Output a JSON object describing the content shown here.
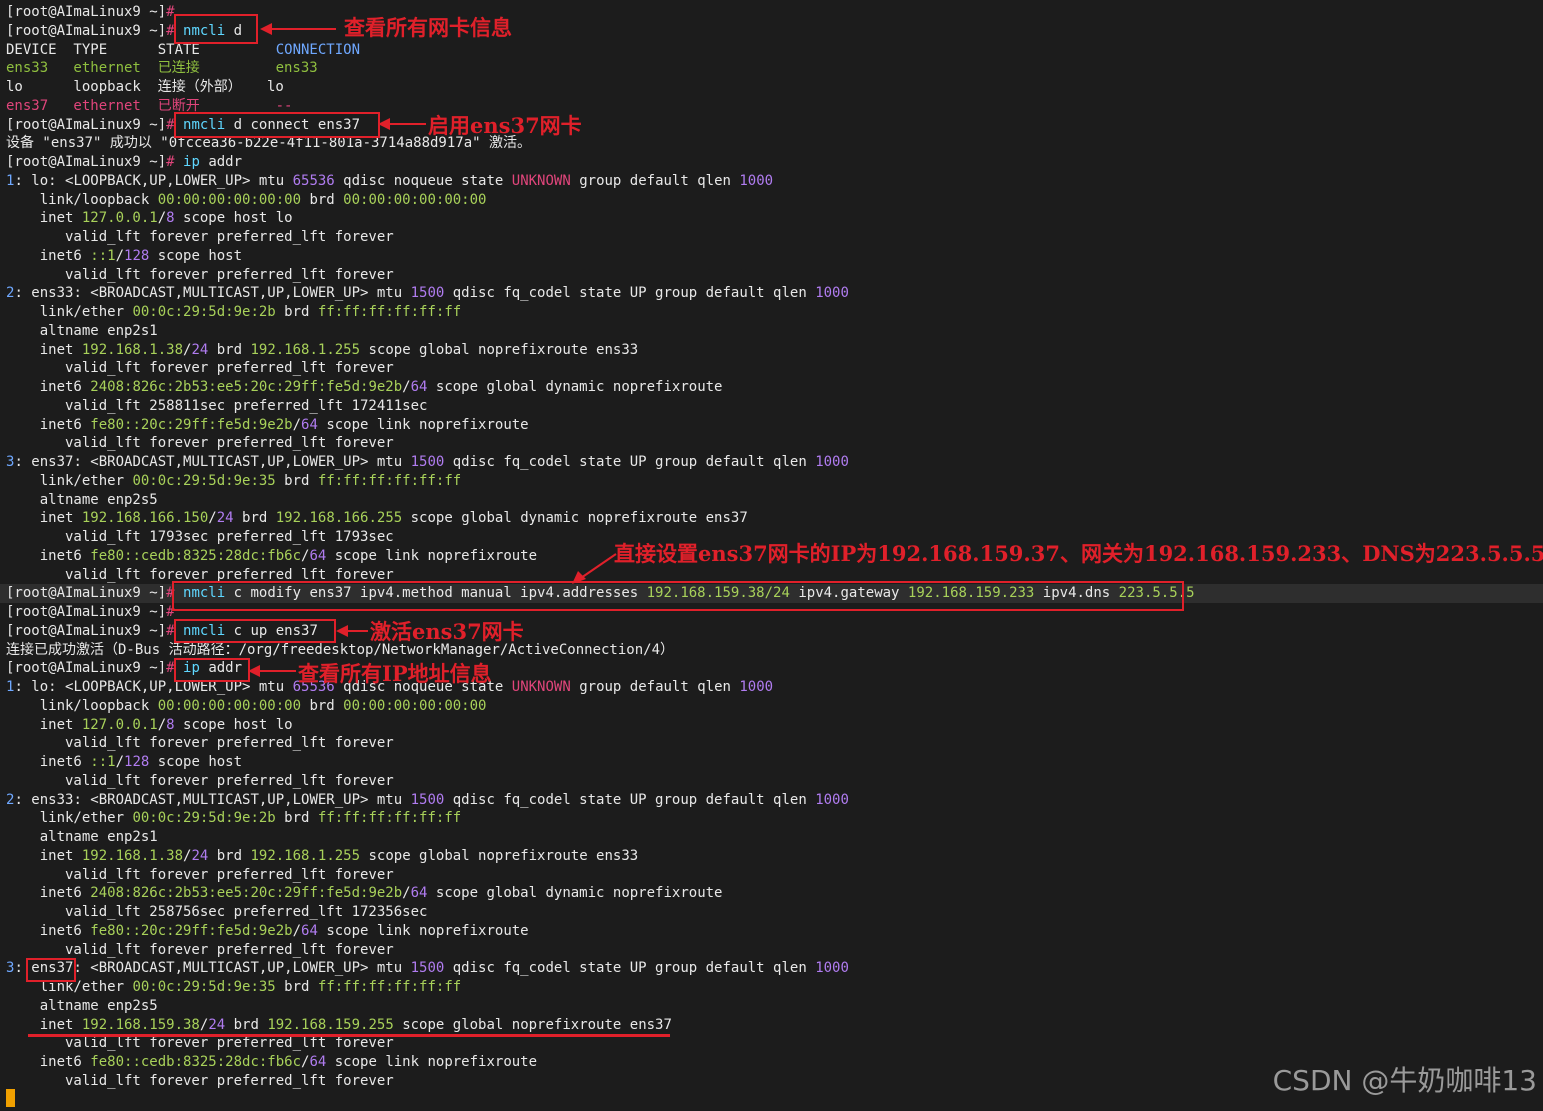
{
  "prompt": "[root@AImaLinux9 ~]",
  "hash": "#",
  "annotations": {
    "a1": "查看所有网卡信息",
    "a2": "启用ens37网卡",
    "a3": "直接设置ens37网卡的IP为192.168.159.37、网关为192.168.159.233、DNS为223.5.5.5",
    "a4": "激活ens37网卡",
    "a5": "查看所有IP地址信息"
  },
  "watermark": "CSDN @牛奶咖啡13",
  "lines": [
    [
      [
        "[root@AImaLinux9 ~]",
        "w"
      ],
      [
        "#",
        "rd"
      ]
    ],
    [
      [
        "[root@AImaLinux9 ~]",
        "w"
      ],
      [
        "#",
        "rd"
      ],
      [
        " nmcli",
        "cy"
      ],
      [
        " d",
        "w"
      ]
    ],
    [
      [
        "DEVICE  TYPE      STATE         ",
        "w"
      ],
      [
        "CONNECTION",
        "bl"
      ]
    ],
    [
      [
        "ens33   ethernet  已连接         ens33",
        "gr"
      ]
    ],
    [
      [
        "lo      loopback  连接（外部）   lo",
        "yl"
      ]
    ],
    [
      [
        "ens37   ethernet  已断开         --",
        "rd"
      ]
    ],
    [
      [
        "[root@AImaLinux9 ~]",
        "w"
      ],
      [
        "#",
        "rd"
      ],
      [
        " nmcli",
        "cy"
      ],
      [
        " d connect ens37",
        "w"
      ]
    ],
    [
      [
        "设备 \"ens37\" 成功以 \"0fccea36-b22e-4f11-801a-3714a88d917a\" 激活。",
        "w"
      ]
    ],
    [
      [
        "[root@AImaLinux9 ~]",
        "w"
      ],
      [
        "#",
        "rd"
      ],
      [
        " ip",
        "cy"
      ],
      [
        " addr",
        "w"
      ]
    ],
    [
      [
        "1",
        "bl"
      ],
      [
        ": lo: <LOOPBACK,UP,LOWER_UP> mtu ",
        "w"
      ],
      [
        "65536",
        "pu"
      ],
      [
        " qdisc noqueue state ",
        "w"
      ],
      [
        "UNKNOWN",
        "rd"
      ],
      [
        " group default qlen ",
        "w"
      ],
      [
        "1000",
        "pu"
      ]
    ],
    [
      [
        "    link/loopback ",
        "w"
      ],
      [
        "00:00:00:00:00:00",
        "gr2"
      ],
      [
        " brd ",
        "w"
      ],
      [
        "00:00:00:00:00:00",
        "gr2"
      ]
    ],
    [
      [
        "    inet ",
        "w"
      ],
      [
        "127.0.0.1",
        "gr2"
      ],
      [
        "/",
        "w"
      ],
      [
        "8",
        "pu"
      ],
      [
        " scope host lo",
        "w"
      ]
    ],
    [
      [
        "       valid_lft forever preferred_lft forever",
        "w"
      ]
    ],
    [
      [
        "    inet6 ",
        "w"
      ],
      [
        "::1",
        "gr2"
      ],
      [
        "/",
        "w"
      ],
      [
        "128",
        "pu"
      ],
      [
        " scope host",
        "w"
      ]
    ],
    [
      [
        "       valid_lft forever preferred_lft forever",
        "w"
      ]
    ],
    [
      [
        "2",
        "bl"
      ],
      [
        ": ens33: <BROADCAST,MULTICAST,UP,LOWER_UP> mtu ",
        "w"
      ],
      [
        "1500",
        "pu"
      ],
      [
        " qdisc fq_codel state UP group default qlen ",
        "w"
      ],
      [
        "1000",
        "pu"
      ]
    ],
    [
      [
        "    link/ether ",
        "w"
      ],
      [
        "00:0c:29:5d:9e:2b",
        "gr2"
      ],
      [
        " brd ",
        "w"
      ],
      [
        "ff:ff:ff:ff:ff:ff",
        "gr2"
      ]
    ],
    [
      [
        "    altname enp2s1",
        "w"
      ]
    ],
    [
      [
        "    inet ",
        "w"
      ],
      [
        "192.168.1.38",
        "gr2"
      ],
      [
        "/",
        "w"
      ],
      [
        "24",
        "pu"
      ],
      [
        " brd ",
        "w"
      ],
      [
        "192.168.1.255",
        "gr2"
      ],
      [
        " scope global noprefixroute ens33",
        "w"
      ]
    ],
    [
      [
        "       valid_lft forever preferred_lft forever",
        "w"
      ]
    ],
    [
      [
        "    inet6 ",
        "w"
      ],
      [
        "2408:826c:2b53:ee5:20c:29ff:fe5d:9e2b",
        "gr2"
      ],
      [
        "/",
        "w"
      ],
      [
        "64",
        "pu"
      ],
      [
        " scope global dynamic noprefixroute",
        "w"
      ]
    ],
    [
      [
        "       valid_lft 258811sec preferred_lft 172411sec",
        "w"
      ]
    ],
    [
      [
        "    inet6 ",
        "w"
      ],
      [
        "fe80::20c:29ff:fe5d:9e2b",
        "gr2"
      ],
      [
        "/",
        "w"
      ],
      [
        "64",
        "pu"
      ],
      [
        " scope link noprefixroute",
        "w"
      ]
    ],
    [
      [
        "       valid_lft forever preferred_lft forever",
        "w"
      ]
    ],
    [
      [
        "3",
        "bl"
      ],
      [
        ": ens37: <BROADCAST,MULTICAST,UP,LOWER_UP> mtu ",
        "w"
      ],
      [
        "1500",
        "pu"
      ],
      [
        " qdisc fq_codel state UP group default qlen ",
        "w"
      ],
      [
        "1000",
        "pu"
      ]
    ],
    [
      [
        "    link/ether ",
        "w"
      ],
      [
        "00:0c:29:5d:9e:35",
        "gr2"
      ],
      [
        " brd ",
        "w"
      ],
      [
        "ff:ff:ff:ff:ff:ff",
        "gr2"
      ]
    ],
    [
      [
        "    altname enp2s5",
        "w"
      ]
    ],
    [
      [
        "    inet ",
        "w"
      ],
      [
        "192.168.166.150",
        "gr2"
      ],
      [
        "/",
        "w"
      ],
      [
        "24",
        "pu"
      ],
      [
        " brd ",
        "w"
      ],
      [
        "192.168.166.255",
        "gr2"
      ],
      [
        " scope global dynamic noprefixroute ens37",
        "w"
      ]
    ],
    [
      [
        "       valid_lft 1793sec preferred_lft 1793sec",
        "w"
      ]
    ],
    [
      [
        "    inet6 ",
        "w"
      ],
      [
        "fe80::cedb:8325:28dc:fb6c",
        "gr2"
      ],
      [
        "/",
        "w"
      ],
      [
        "64",
        "pu"
      ],
      [
        " scope link noprefixroute",
        "w"
      ]
    ],
    [
      [
        "       valid_lft forever preferred_lft forever",
        "w"
      ]
    ],
    [
      [
        "[root@AImaLinux9 ~]",
        "w"
      ],
      [
        "#",
        "rd"
      ],
      [
        " nmcli",
        "cy"
      ],
      [
        " c modify ens37 ipv4.method manual ipv4.addresses ",
        "w"
      ],
      [
        "192.168.159.38/24",
        "gr2"
      ],
      [
        " ipv4.gateway ",
        "w"
      ],
      [
        "192.168.159.233",
        "gr2"
      ],
      [
        " ipv4.dns ",
        "w"
      ],
      [
        "223.5.5.5",
        "gr2"
      ]
    ],
    [
      [
        "[root@AImaLinux9 ~]",
        "w"
      ],
      [
        "#",
        "rd"
      ]
    ],
    [
      [
        "[root@AImaLinux9 ~]",
        "w"
      ],
      [
        "#",
        "rd"
      ],
      [
        " nmcli",
        "cy"
      ],
      [
        " c up ens37",
        "w"
      ]
    ],
    [
      [
        "连接已成功激活（D-Bus 活动路径：/org/freedesktop/NetworkManager/ActiveConnection/4）",
        "w"
      ]
    ],
    [
      [
        "[root@AImaLinux9 ~]",
        "w"
      ],
      [
        "#",
        "rd"
      ],
      [
        " ip",
        "cy"
      ],
      [
        " addr",
        "w"
      ]
    ],
    [
      [
        "1",
        "bl"
      ],
      [
        ": lo: <LOOPBACK,UP,LOWER_UP> mtu ",
        "w"
      ],
      [
        "65536",
        "pu"
      ],
      [
        " qdisc noqueue state ",
        "w"
      ],
      [
        "UNKNOWN",
        "rd"
      ],
      [
        " group default qlen ",
        "w"
      ],
      [
        "1000",
        "pu"
      ]
    ],
    [
      [
        "    link/loopback ",
        "w"
      ],
      [
        "00:00:00:00:00:00",
        "gr2"
      ],
      [
        " brd ",
        "w"
      ],
      [
        "00:00:00:00:00:00",
        "gr2"
      ]
    ],
    [
      [
        "    inet ",
        "w"
      ],
      [
        "127.0.0.1",
        "gr2"
      ],
      [
        "/",
        "w"
      ],
      [
        "8",
        "pu"
      ],
      [
        " scope host lo",
        "w"
      ]
    ],
    [
      [
        "       valid_lft forever preferred_lft forever",
        "w"
      ]
    ],
    [
      [
        "    inet6 ",
        "w"
      ],
      [
        "::1",
        "gr2"
      ],
      [
        "/",
        "w"
      ],
      [
        "128",
        "pu"
      ],
      [
        " scope host",
        "w"
      ]
    ],
    [
      [
        "       valid_lft forever preferred_lft forever",
        "w"
      ]
    ],
    [
      [
        "2",
        "bl"
      ],
      [
        ": ens33: <BROADCAST,MULTICAST,UP,LOWER_UP> mtu ",
        "w"
      ],
      [
        "1500",
        "pu"
      ],
      [
        " qdisc fq_codel state UP group default qlen ",
        "w"
      ],
      [
        "1000",
        "pu"
      ]
    ],
    [
      [
        "    link/ether ",
        "w"
      ],
      [
        "00:0c:29:5d:9e:2b",
        "gr2"
      ],
      [
        " brd ",
        "w"
      ],
      [
        "ff:ff:ff:ff:ff:ff",
        "gr2"
      ]
    ],
    [
      [
        "    altname enp2s1",
        "w"
      ]
    ],
    [
      [
        "    inet ",
        "w"
      ],
      [
        "192.168.1.38",
        "gr2"
      ],
      [
        "/",
        "w"
      ],
      [
        "24",
        "pu"
      ],
      [
        " brd ",
        "w"
      ],
      [
        "192.168.1.255",
        "gr2"
      ],
      [
        " scope global noprefixroute ens33",
        "w"
      ]
    ],
    [
      [
        "       valid_lft forever preferred_lft forever",
        "w"
      ]
    ],
    [
      [
        "    inet6 ",
        "w"
      ],
      [
        "2408:826c:2b53:ee5:20c:29ff:fe5d:9e2b",
        "gr2"
      ],
      [
        "/",
        "w"
      ],
      [
        "64",
        "pu"
      ],
      [
        " scope global dynamic noprefixroute",
        "w"
      ]
    ],
    [
      [
        "       valid_lft 258756sec preferred_lft 172356sec",
        "w"
      ]
    ],
    [
      [
        "    inet6 ",
        "w"
      ],
      [
        "fe80::20c:29ff:fe5d:9e2b",
        "gr2"
      ],
      [
        "/",
        "w"
      ],
      [
        "64",
        "pu"
      ],
      [
        " scope link noprefixroute",
        "w"
      ]
    ],
    [
      [
        "       valid_lft forever preferred_lft forever",
        "w"
      ]
    ],
    [
      [
        "3",
        "bl"
      ],
      [
        ": ens37: <BROADCAST,MULTICAST,UP,LOWER_UP> mtu ",
        "w"
      ],
      [
        "1500",
        "pu"
      ],
      [
        " qdisc fq_codel state UP group default qlen ",
        "w"
      ],
      [
        "1000",
        "pu"
      ]
    ],
    [
      [
        "    link/ether ",
        "w"
      ],
      [
        "00:0c:29:5d:9e:35",
        "gr2"
      ],
      [
        " brd ",
        "w"
      ],
      [
        "ff:ff:ff:ff:ff:ff",
        "gr2"
      ]
    ],
    [
      [
        "    altname enp2s5",
        "w"
      ]
    ],
    [
      [
        "    inet ",
        "w"
      ],
      [
        "192.168.159.38",
        "gr2"
      ],
      [
        "/",
        "w"
      ],
      [
        "24",
        "pu"
      ],
      [
        " brd ",
        "w"
      ],
      [
        "192.168.159.255",
        "gr2"
      ],
      [
        " scope global noprefixroute ens37",
        "w"
      ]
    ],
    [
      [
        "       valid_lft forever preferred_lft forever",
        "w"
      ]
    ],
    [
      [
        "    inet6 ",
        "w"
      ],
      [
        "fe80::cedb:8325:28dc:fb6c",
        "gr2"
      ],
      [
        "/",
        "w"
      ],
      [
        "64",
        "pu"
      ],
      [
        " scope link noprefixroute",
        "w"
      ]
    ],
    [
      [
        "       valid_lft forever preferred_lft forever",
        "w"
      ]
    ]
  ]
}
